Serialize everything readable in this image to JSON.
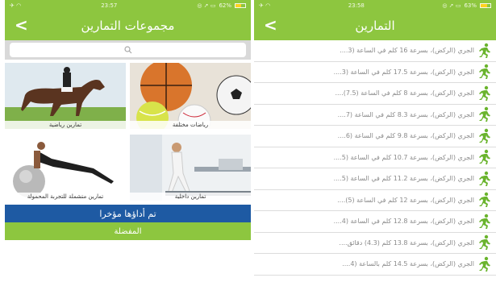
{
  "left": {
    "status": {
      "time": "23:57",
      "battery": "62%",
      "battery_fill": 0.62
    },
    "title": "مجموعات التمارين",
    "back_icon": "chevron-left-icon",
    "search": {
      "placeholder": "",
      "icon": "search-icon"
    },
    "tiles": [
      {
        "caption": "تمارين رياضية"
      },
      {
        "caption": "رياضات مختلفة"
      },
      {
        "caption": "تمارين متشملة للتجربة المحمولة"
      },
      {
        "caption": "تمارين داخلية"
      }
    ],
    "recent_button": "تم أداؤها مؤخرا",
    "favorites_button": "المفضلة"
  },
  "right": {
    "status": {
      "time": "23:58",
      "battery": "63%",
      "battery_fill": 0.63
    },
    "title": "التمارين",
    "back_icon": "chevron-left-icon",
    "item_icon": "runner-icon",
    "items": [
      "الجري (الركض)، بسرعة 16 كلم في الساعة (3....",
      "الجري (الركض)، بسرعة 17.5 كلم في الساعة (3....",
      "الجري (الركض)، بسرعة 8 كلم في الساعة (7.5)....",
      "الجري (الركض)، بسرعة 8.3 كلم في الساعة (7....",
      "الجري (الركض)، بسرعة 9.8 كلم في الساعة (6....",
      "الجري (الركض)، بسرعة 10.7 كلم في الساعة (5....",
      "الجري (الركض)، بسرعة 11.2 كلم في الساعة (5....",
      "الجري (الركض)، بسرعة 12 كلم في الساعة (5)....",
      "الجري (الركض)، بسرعة 12.8 كلم في الساعة (4....",
      "الجري (الركض)، بسرعة 13.8 كلم (4.3) دقائق....",
      "الجري (الركض)، بسرعة 14.5 كلم بالساعة (4...."
    ]
  },
  "colors": {
    "green": "#8dc63f",
    "blue": "#1e5aa3",
    "divider": "#dcdcdc"
  }
}
